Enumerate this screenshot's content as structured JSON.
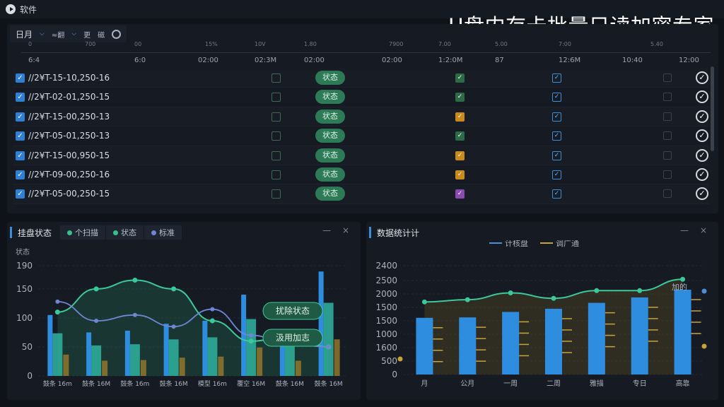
{
  "app": {
    "title": "软件",
    "headline": "U盘内存卡批量只读加密专家",
    "window_controls": "— ×"
  },
  "toolbar": {
    "item1": "日月",
    "item2": "≈翻",
    "item3": "更",
    "item4": "磁"
  },
  "ticks": [
    "0",
    "700",
    "00",
    "15%",
    "10V",
    "1.80",
    "7900",
    "7.00",
    "5.00",
    "7:00",
    "5.40"
  ],
  "times": [
    "6:4",
    "6:0",
    "02:00",
    "02:3M",
    "02:00",
    "02:00",
    "1:2:0M",
    "87",
    "12:6M",
    "10:40",
    "12:00"
  ],
  "rows": [
    {
      "id": "//2¥T-15-10,250-16",
      "pill": "状态",
      "c2_color": "#2c6b45",
      "c3": true
    },
    {
      "id": "//2¥T-02-01,250-15",
      "pill": "状态",
      "c2_color": "#2c6b45",
      "c3": true
    },
    {
      "id": "//2¥T-15-00,250-13",
      "pill": "状态",
      "c2_color": "#c88a1c",
      "c3": true
    },
    {
      "id": "//2¥T-05-01,250-13",
      "pill": "状态",
      "c2_color": "#2c6b45",
      "c3": true
    },
    {
      "id": "//2¥T-15-00,950-15",
      "pill": "状态",
      "c2_color": "#c88a1c",
      "c3": true
    },
    {
      "id": "//2¥T-09-00,250-16",
      "pill": "状态",
      "c2_color": "#c88a1c",
      "c3": true
    },
    {
      "id": "//2¥T-05-00,250-15",
      "pill": "状态",
      "c2_color": "#8a4ab0",
      "c3": true
    }
  ],
  "left_panel": {
    "title": "挂盘状态",
    "legend": [
      {
        "label": "个扫描",
        "color": "#36c08a"
      },
      {
        "label": "状态",
        "color": "#36c08a"
      },
      {
        "label": "标准",
        "color": "#6f86d6"
      }
    ],
    "callouts": [
      "扰除状态",
      "汲用加志"
    ]
  },
  "right_panel": {
    "title": "数据统计计",
    "legend": [
      {
        "label": "计核盘",
        "color": "#4b8fd8"
      },
      {
        "label": "调广通",
        "color": "#c8a23a"
      }
    ],
    "annotation": "加的"
  },
  "chart_data": [
    {
      "type": "bar",
      "title": "挂盘状态",
      "ylabel": "状态",
      "ylim": [
        0,
        190
      ],
      "yticks": [
        0,
        50,
        100,
        150,
        190
      ],
      "categories": [
        "鼓条 16m",
        "鼓条 16M",
        "鼓条 16m",
        "鼓条 16M",
        "模型 16m",
        "覆空 16M",
        "鼓条 16M",
        "鼓条 16M"
      ],
      "series": [
        {
          "name": "个扫描",
          "type": "bar",
          "values": [
            105,
            75,
            78,
            90,
            95,
            140,
            75,
            180
          ]
        },
        {
          "name": "状态",
          "type": "line",
          "values": [
            110,
            150,
            165,
            150,
            95,
            60,
            70,
            50
          ]
        },
        {
          "name": "标准",
          "type": "line",
          "values": [
            128,
            95,
            105,
            85,
            115,
            70,
            55,
            50
          ]
        }
      ]
    },
    {
      "type": "bar",
      "title": "数据统计计",
      "ylim": [
        0,
        2400
      ],
      "yticks": [
        0,
        500,
        1600,
        1000,
        1500,
        1500,
        2000,
        2500,
        2400
      ],
      "categories": [
        "月",
        "公月",
        "一周",
        "二周",
        "雅描",
        "专日",
        "高靠"
      ],
      "series": [
        {
          "name": "计核盘",
          "type": "bar",
          "values": [
            1250,
            1260,
            1380,
            1450,
            1580,
            1700,
            1870
          ]
        },
        {
          "name": "调广通",
          "type": "line",
          "values": [
            1600,
            1650,
            1800,
            1680,
            1850,
            1850,
            2100
          ]
        }
      ]
    }
  ]
}
